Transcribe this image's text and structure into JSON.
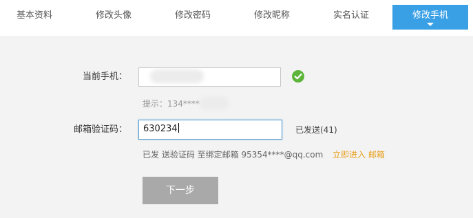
{
  "tabs": [
    {
      "label": "基本资料"
    },
    {
      "label": "修改头像"
    },
    {
      "label": "修改密码"
    },
    {
      "label": "修改昵称"
    },
    {
      "label": "实名认证"
    },
    {
      "label": "修改手机",
      "active": true
    }
  ],
  "form": {
    "current_phone_label": "当前手机：",
    "current_phone_value": "",
    "hint": "提示：134****",
    "email_code_label": "邮箱验证码：",
    "email_code_value": "630234",
    "sent_status": "已发送(41)",
    "notice": "已发 送验证码 至绑定邮箱  95354****@qq.com",
    "enter_email_link": "立即进入 邮箱",
    "next_button": "下一步"
  },
  "colors": {
    "active_tab": "#3aa0e6",
    "check": "#5cb53a",
    "link": "#e8a020",
    "button": "#a9a9a9"
  }
}
